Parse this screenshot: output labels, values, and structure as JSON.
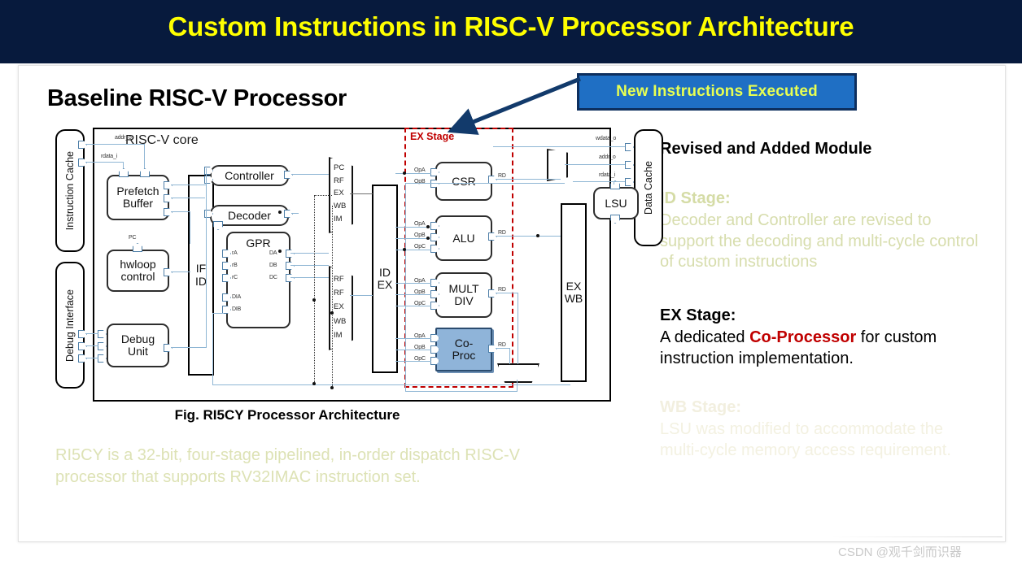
{
  "title": "Custom Instructions in RISC-V Processor Architecture",
  "slide": {
    "baseline_heading": "Baseline RISC-V Processor",
    "figure_caption": "Fig. RI5CY Processor  Architecture",
    "riscy_note": "RI5CY is a 32-bit, four-stage pipelined, in-order dispatch RISC-V processor that supports RV32IMAC instruction set."
  },
  "callout": {
    "label": "New Instructions Executed",
    "box_color": "#1f6fc4",
    "border_color": "#0d2f5e",
    "text_color": "#e8ff52"
  },
  "right_panel": {
    "heading": "Revised and Added Module",
    "id_stage": {
      "title": "ID Stage:",
      "body": "Decoder and Controller are revised to support the decoding and multi-cycle control of custom instructions",
      "color": "#d7ddad"
    },
    "ex_stage": {
      "title": "EX Stage:",
      "body_before": "A dedicated ",
      "highlight": "Co-Processor",
      "body_after": " for custom instruction implementation.",
      "highlight_color": "#c00000"
    },
    "wb_stage": {
      "title": "WB Stage:",
      "body": "LSU was modified to accommodate the multi-cycle memory access requirement.",
      "color": "#f3f1e1"
    }
  },
  "diagram": {
    "core_title": "RISC-V core",
    "ex_stage_label": "EX Stage",
    "ex_stage_color": "#c00000",
    "side_blocks": [
      {
        "name": "instruction-cache",
        "label": "Instruction Cache"
      },
      {
        "name": "debug-interface",
        "label": "Debug Interface"
      },
      {
        "name": "data-cache",
        "label": "Data Cache"
      }
    ],
    "modules": [
      {
        "name": "prefetch-buffer",
        "label": "Prefetch\nBuffer"
      },
      {
        "name": "hwloop-control",
        "label": "hwloop\ncontrol"
      },
      {
        "name": "debug-unit",
        "label": "Debug\nUnit"
      },
      {
        "name": "controller",
        "label": "Controller"
      },
      {
        "name": "decoder",
        "label": "Decoder"
      },
      {
        "name": "gpr",
        "label": "GPR"
      },
      {
        "name": "csr",
        "label": "CSR"
      },
      {
        "name": "alu",
        "label": "ALU"
      },
      {
        "name": "mult-div",
        "label": "MULT\nDIV"
      },
      {
        "name": "co-proc",
        "label": "Co-\nProc"
      },
      {
        "name": "lsu",
        "label": "LSU"
      }
    ],
    "pipeline_registers": [
      {
        "name": "if-id",
        "label": "IF\nID"
      },
      {
        "name": "id-ex",
        "label": "ID\nEX"
      },
      {
        "name": "ex-wb",
        "label": "EX\nWB"
      }
    ],
    "mux_top_labels": [
      "PC",
      "RF",
      "EX",
      "WB",
      "IM"
    ],
    "mux_bottom_labels": [
      "RF",
      "RF",
      "EX",
      "WB",
      "IM"
    ],
    "gpr_inputs": [
      "rA",
      "rB",
      "rC",
      "DIA",
      "DIB"
    ],
    "gpr_outputs": [
      "DA",
      "DB",
      "DC"
    ],
    "operand_ports": [
      "OpA",
      "OpB",
      "OpC"
    ],
    "result_port": "RD",
    "signals": {
      "icache_addr": "addr_o",
      "icache_rdata": "rdata_i",
      "dcache_wdata": "wdata_o",
      "dcache_addr": "addr_o",
      "dcache_rdata": "rdata_i",
      "pc_label": "PC"
    }
  },
  "watermark": "CSDN @观千剑而识器"
}
